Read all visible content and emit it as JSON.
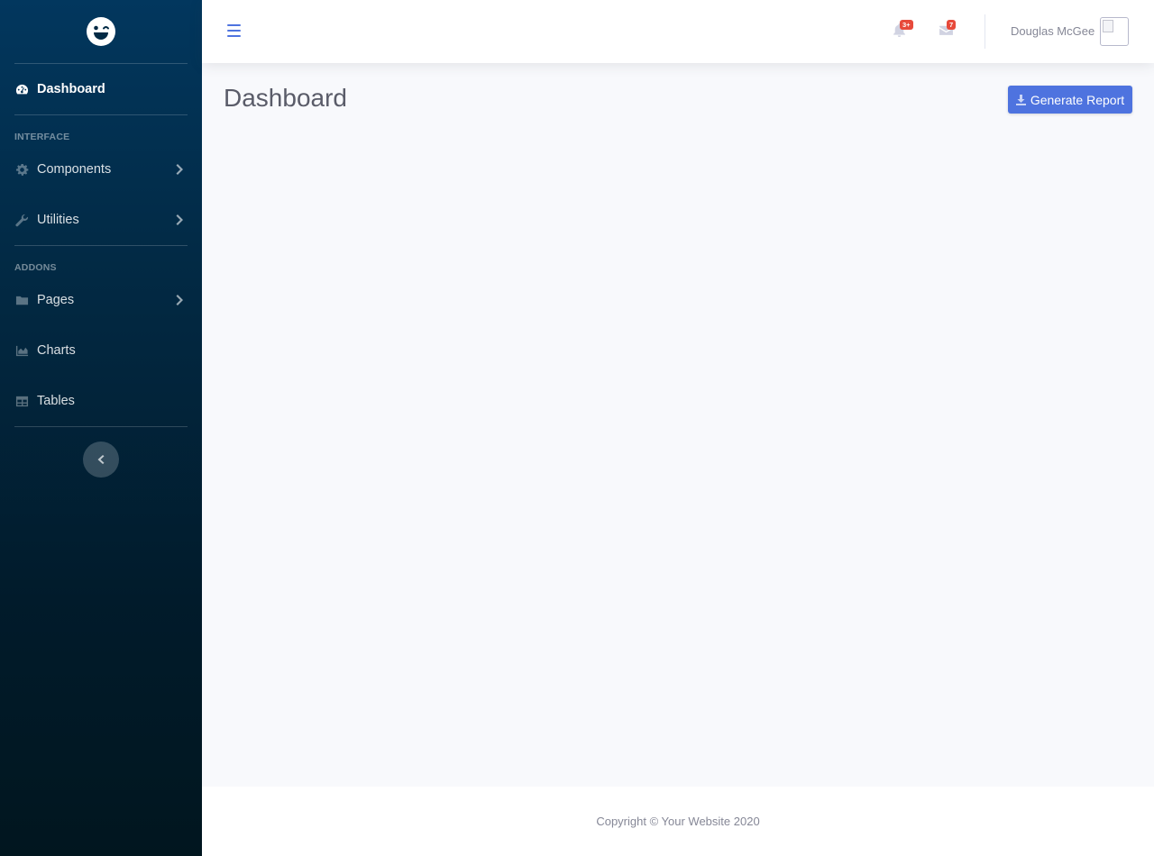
{
  "sidebar": {
    "brand_icon": "laugh-wink-icon",
    "items": [
      {
        "label": "Dashboard",
        "icon": "tachometer-icon",
        "active": true
      },
      {
        "label": "Components",
        "icon": "gear-icon",
        "has_submenu": true
      },
      {
        "label": "Utilities",
        "icon": "wrench-icon",
        "has_submenu": true
      },
      {
        "label": "Pages",
        "icon": "folder-icon",
        "has_submenu": true
      },
      {
        "label": "Charts",
        "icon": "area-chart-icon"
      },
      {
        "label": "Tables",
        "icon": "table-icon"
      }
    ],
    "headings": {
      "interface": "INTERFACE",
      "addons": "ADDONS"
    }
  },
  "topbar": {
    "alerts_badge": "3+",
    "messages_badge": "7",
    "user_name": "Douglas McGee"
  },
  "main": {
    "title": "Dashboard",
    "report_button": "Generate Report"
  },
  "footer": {
    "copyright": "Copyright © Your Website 2020"
  },
  "colors": {
    "primary": "#4e73df",
    "badge": "#e74a3b",
    "sidebar_top": "#02375e",
    "sidebar_bottom": "#01161f"
  }
}
